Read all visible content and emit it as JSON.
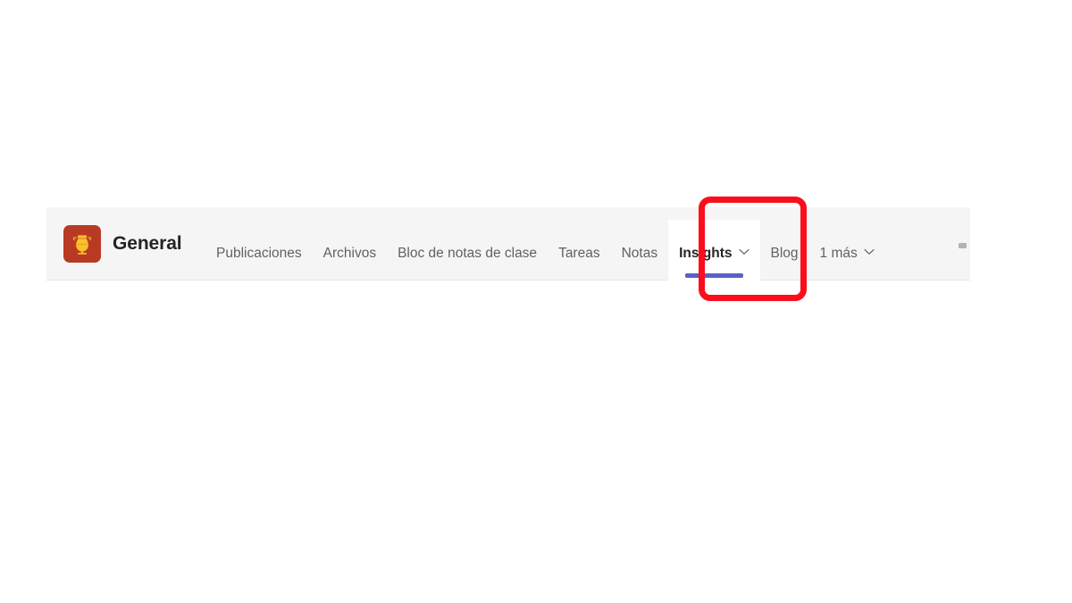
{
  "channel_header": {
    "avatar": {
      "icon": "amphora-vase-icon",
      "background_color": "#b93a22",
      "glyph_color": "#f0b429"
    },
    "channel_name": "General",
    "tabs": [
      {
        "label": "Publicaciones",
        "active": false,
        "has_chevron": false
      },
      {
        "label": "Archivos",
        "active": false,
        "has_chevron": false
      },
      {
        "label": "Bloc de notas de clase",
        "active": false,
        "has_chevron": false
      },
      {
        "label": "Tareas",
        "active": false,
        "has_chevron": false
      },
      {
        "label": "Notas",
        "active": false,
        "has_chevron": false
      },
      {
        "label": "Insights",
        "active": true,
        "has_chevron": true
      },
      {
        "label": "Blog",
        "active": false,
        "has_chevron": false
      },
      {
        "label": "1 más",
        "active": false,
        "has_chevron": true
      }
    ],
    "overflow_icon": "more-options-icon",
    "active_tab_indicator_color": "#5b5fc7",
    "background_color": "#f5f5f5"
  },
  "annotation": {
    "highlight_target": "Insights",
    "color": "#fc0d1b"
  }
}
